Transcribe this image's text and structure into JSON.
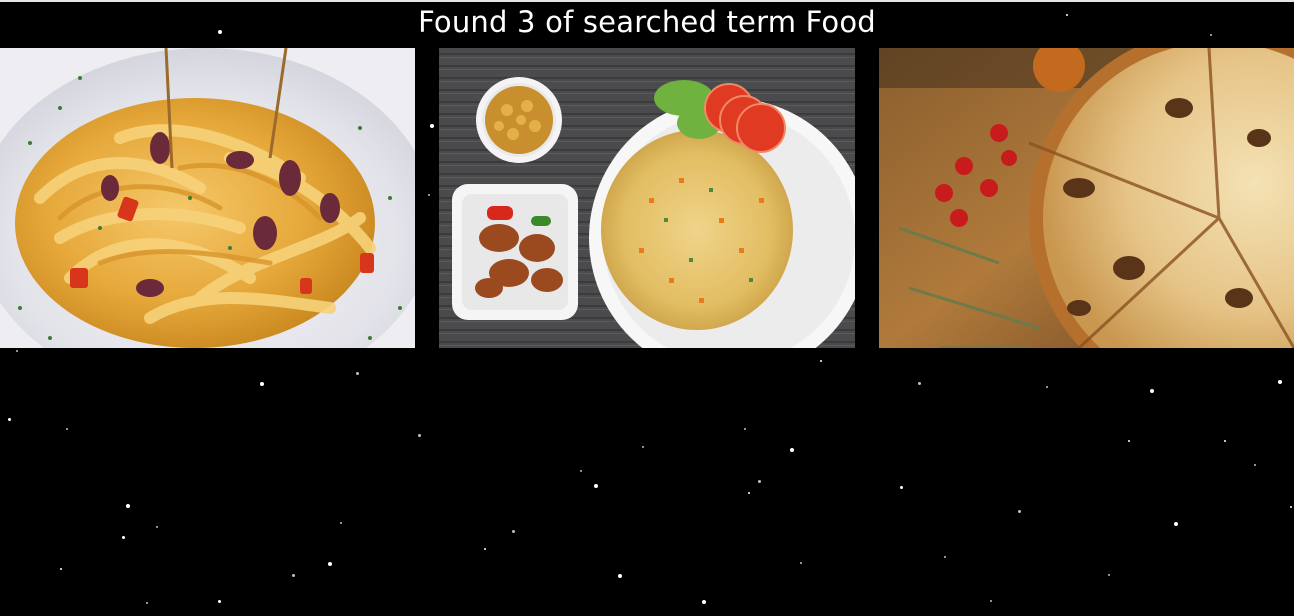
{
  "header": {
    "title": "Found 3 of searched term Food"
  },
  "results": [
    {
      "id": "pasta",
      "image": "pasta-dish-image"
    },
    {
      "id": "rice",
      "image": "fried-rice-plate-image"
    },
    {
      "id": "pizza",
      "image": "pizza-on-board-image"
    }
  ],
  "theme": {
    "background": "#000000",
    "text": "#ffffff",
    "star": "#ffffff"
  }
}
